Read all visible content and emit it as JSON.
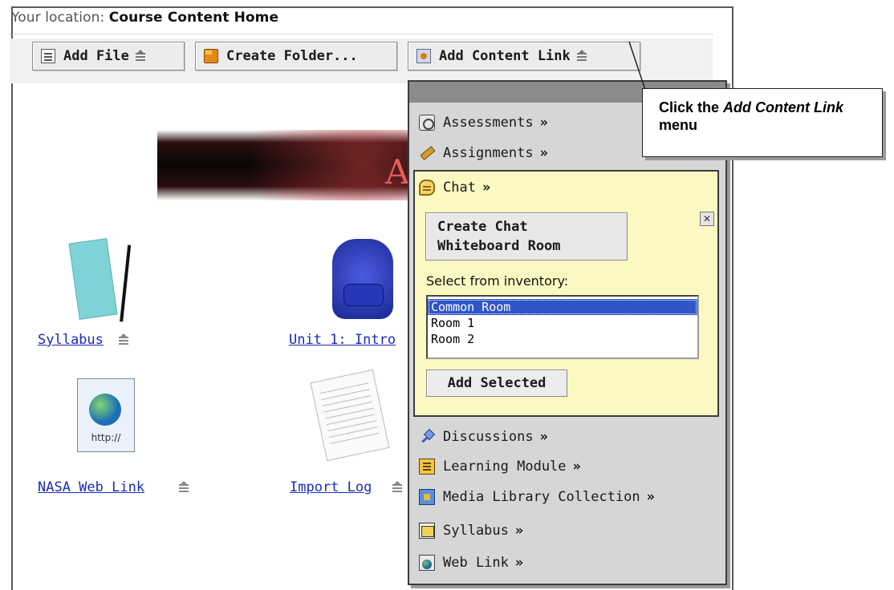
{
  "location": {
    "label": "Your location:",
    "value": "Course Content Home"
  },
  "toolbar": {
    "add_file_label": "Add File",
    "create_folder_label": "Create Folder...",
    "add_content_link_label": "Add Content Link"
  },
  "banner": {
    "visible_letter": "A"
  },
  "items": [
    {
      "label": "Syllabus"
    },
    {
      "label": "Unit 1: Intro"
    },
    {
      "label": "NASA Web Link",
      "thumb_text": "http://"
    },
    {
      "label": "Import Log"
    }
  ],
  "menu": {
    "items": [
      {
        "label": "Assessments",
        "suffix": "»",
        "icon": "assessments-icon"
      },
      {
        "label": "Assignments",
        "suffix": "»",
        "icon": "assignments-icon"
      },
      {
        "label": "Chat",
        "suffix": "»",
        "icon": "chat-icon"
      },
      {
        "label": "Discussions",
        "suffix": "»",
        "icon": "discussions-icon"
      },
      {
        "label": "Learning Module",
        "suffix": "»",
        "icon": "learning-module-icon"
      },
      {
        "label": "Media Library Collection",
        "suffix": "»",
        "icon": "media-library-icon"
      },
      {
        "label": "Syllabus",
        "suffix": "»",
        "icon": "syllabus-icon"
      },
      {
        "label": "Web Link",
        "suffix": "»",
        "icon": "web-link-icon"
      }
    ]
  },
  "chat_panel": {
    "create_button_label": "Create Chat\nWhiteboard Room",
    "close_glyph": "✕",
    "select_label": "Select from inventory:",
    "options": [
      "Common Room",
      "Room 1",
      "Room 2"
    ],
    "selected_option": "Common Room",
    "add_selected_label": "Add Selected"
  },
  "callout": {
    "prefix": "Click the ",
    "emphasis": "Add Content Link",
    "suffix": " menu"
  },
  "colors": {
    "link": "#1a2bb8",
    "chat_panel_bg": "#fcf8c2",
    "selection": "#2f55c9",
    "menu_bg": "#d6d6d6"
  }
}
